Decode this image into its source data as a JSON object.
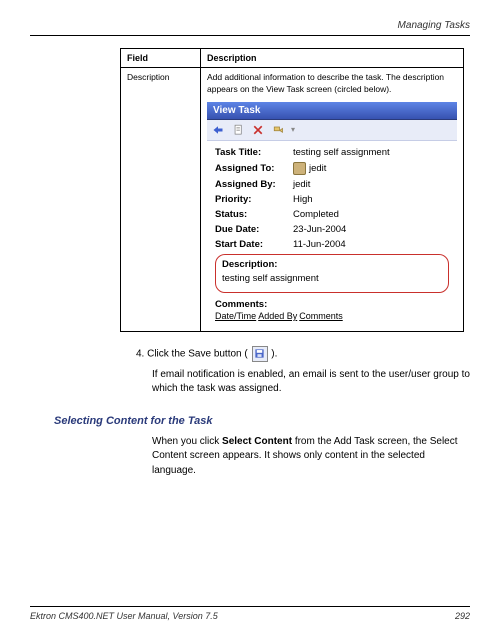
{
  "header": {
    "right": "Managing Tasks"
  },
  "table": {
    "headers": {
      "field": "Field",
      "description": "Description"
    },
    "row": {
      "field": "Description",
      "desc": "Add additional information to describe the task. The description appears on the View Task screen (circled below)."
    }
  },
  "viewtask": {
    "title": "View Task",
    "fields": {
      "task_title_label": "Task Title:",
      "task_title_value": "testing self assignment",
      "assigned_to_label": "Assigned To:",
      "assigned_to_value": "jedit",
      "assigned_by_label": "Assigned By:",
      "assigned_by_value": "jedit",
      "priority_label": "Priority:",
      "priority_value": "High",
      "status_label": "Status:",
      "status_value": "Completed",
      "due_date_label": "Due Date:",
      "due_date_value": "23-Jun-2004",
      "start_date_label": "Start Date:",
      "start_date_value": "11-Jun-2004",
      "description_label": "Description:",
      "description_value": "testing self assignment",
      "comments_label": "Comments:",
      "comments_cols": {
        "c1": "Date/Time",
        "c2": "Added By",
        "c3": "Comments"
      }
    }
  },
  "step4": {
    "prefix": "4.   Click the Save button (",
    "suffix": ").",
    "note": "If email notification is enabled, an email is sent to the user/user group to which the task was assigned."
  },
  "section": {
    "heading": "Selecting Content for the Task",
    "body_pre": "When you click ",
    "body_bold": "Select Content",
    "body_post": " from the Add Task screen, the Select Content screen appears. It shows only content in the selected language."
  },
  "footer": {
    "left": "Ektron CMS400.NET User Manual, Version 7.5",
    "right": "292"
  }
}
